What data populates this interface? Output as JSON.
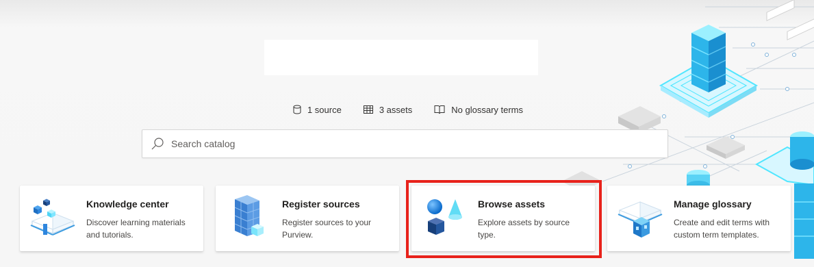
{
  "stats": [
    {
      "icon": "database-icon",
      "text": "1 source"
    },
    {
      "icon": "table-icon",
      "text": "3 assets"
    },
    {
      "icon": "book-icon",
      "text": "No glossary terms"
    }
  ],
  "search": {
    "placeholder": "Search catalog",
    "value": ""
  },
  "cards": [
    {
      "title": "Knowledge center",
      "description": "Discover learning materials and tutorials.",
      "icon": "open-book-cubes-icon"
    },
    {
      "title": "Register sources",
      "description": "Register sources to your Purview.",
      "icon": "stacked-blocks-icon"
    },
    {
      "title": "Browse assets",
      "description": "Explore assets by source type.",
      "icon": "shapes-icon"
    },
    {
      "title": "Manage glossary",
      "description": "Create and edit terms with custom term templates.",
      "icon": "glossary-book-icon"
    }
  ],
  "colors": {
    "accent": "#0078d4",
    "highlight": "#e8221b",
    "art_light": "#50e6ff",
    "art_dark": "#1b4f9b"
  }
}
